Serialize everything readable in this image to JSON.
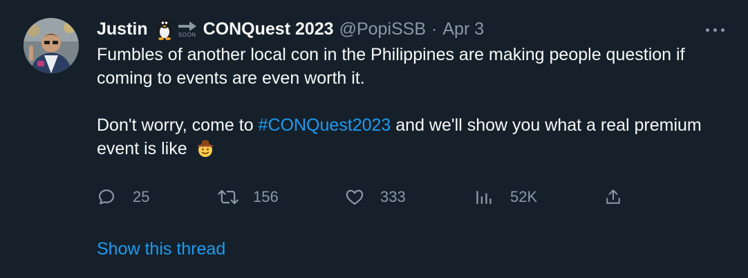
{
  "tweet": {
    "author": {
      "display_name": "Justin",
      "name_suffix": "CONQuest 2023",
      "handle": "@PopiSSB",
      "emoji": [
        "penguin-icon",
        "soon-arrow-icon"
      ],
      "soon_label": "SOON"
    },
    "separator": "·",
    "date": "Apr 3",
    "paragraphs": {
      "p1": "Fumbles of another local con in the Philippines are making people question if coming to events are even worth it.",
      "p2_before": "Don't worry, come to ",
      "p2_hashtag": "#CONQuest2023",
      "p2_after": " and we'll show you what a real premium event is like",
      "p2_emoji": "cowboy-face-icon"
    },
    "actions": {
      "replies": "25",
      "retweets": "156",
      "likes": "333",
      "views": "52K"
    },
    "show_thread": "Show this thread"
  },
  "colors": {
    "background": "#15202b",
    "text": "#f7f9f9",
    "muted": "#8b98a5",
    "accent": "#1d9bf0"
  }
}
